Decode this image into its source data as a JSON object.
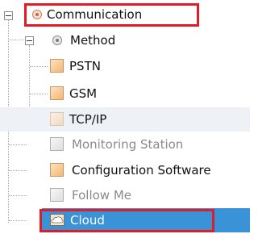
{
  "tree": {
    "communication": {
      "label": "Communication"
    },
    "method": {
      "label": "Method"
    },
    "pstn": {
      "label": "PSTN"
    },
    "gsm": {
      "label": "GSM"
    },
    "tcpip": {
      "label": "TCP/IP"
    },
    "monitoring_station": {
      "label": "Monitoring Station"
    },
    "configuration_software": {
      "label": "Configuration Software"
    },
    "follow_me": {
      "label": "Follow Me"
    },
    "cloud": {
      "label": "Cloud"
    }
  },
  "colors": {
    "selection": "#3a93d6",
    "highlight_outline": "#e01c24",
    "disabled_text": "#8a8a8a"
  }
}
